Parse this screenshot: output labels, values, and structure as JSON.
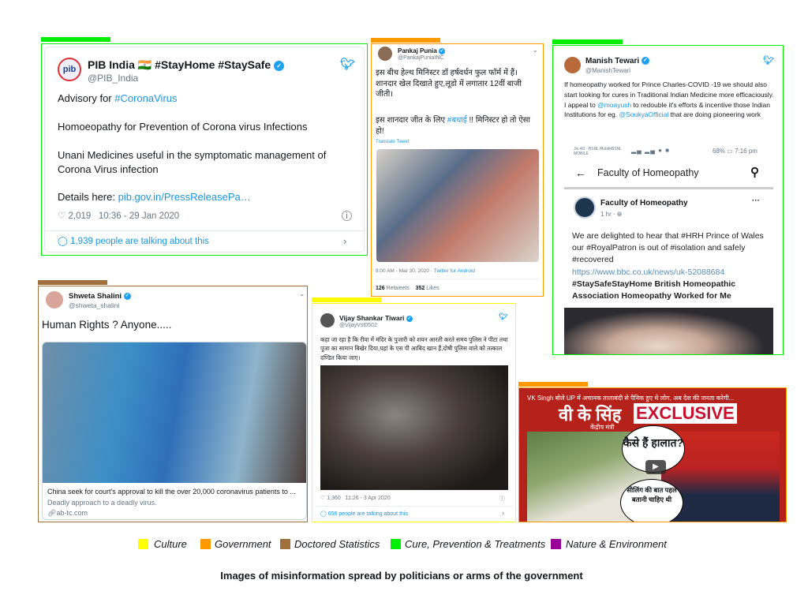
{
  "tweets": {
    "pib": {
      "name": "PIB India 🇮🇳 #StayHome #StaySafe",
      "handle": "@PIB_India",
      "line1_prefix": "Advisory for ",
      "line1_tag": "#CoronaVirus",
      "line2": "Homoeopathy for Prevention of Corona virus Infections",
      "line3": "Unani Medicines useful in the symptomatic management of Corona Virus infection",
      "details_prefix": "Details here: ",
      "details_link": "pib.gov.in/PressReleasePa…",
      "likes": "2,019",
      "time": "10:36 - 29 Jan 2020",
      "talking": "1,939 people are talking about this"
    },
    "pankaj": {
      "name": "Pankaj Punia",
      "handle": "@PankajPuniaINC",
      "text1": "इस बीच हेल्थ मिनिस्टर डॉ हर्षवर्धन फुल फॉर्म में हैं। शानदार खेल दिखाते हुए,लूडो में लगातार 12वीं बाजी जीती।",
      "text2_prefix": "इस शानदार जीत के लिए ",
      "text2_tag": "#बधाई",
      "text2_suffix": " !!  मिनिस्टर हो तो ऐसा हो!",
      "translate": "Translate Tweet",
      "time": "8:00 AM - Mar 30, 2020 · ",
      "source": "Twitter for Android",
      "retweets": "126",
      "retweets_label": "Retweets",
      "likes": "352",
      "likes_label": "Likes"
    },
    "manish": {
      "name": "Manish Tewari",
      "handle": "@ManishTewari",
      "text1": "If homeopathy worked for Prince Charles-COVID -19 we should also start looking for cures in Traditional Indian Medicine more efficaciously.",
      "text2_a": "I appeal to ",
      "mention1": "@moayush",
      "text2_b": " to redouble it's efforts & incentive those Indian Institutions for eg. ",
      "mention2": "@SoukyaOfficial",
      "text2_c": " that are doing pioneering work",
      "screenshot": {
        "carrier": "Jio 4G · BSNL MobileBSNL MOBILE",
        "battery": "68%",
        "clock": "7:16 pm",
        "page_title": "Faculty of Homeopathy",
        "post_author": "Faculty of Homeopathy",
        "post_time": "1 hr ·",
        "post_text": "We are delighted to hear that #HRH Prince of Wales our  #RoyalPatron is out of #isolation and safely #recovered",
        "post_link": "https://www.bbc.co.uk/news/uk-52088684",
        "post_tags": "#StaySafeStayHome British Homeopathic Association Homeopathy Worked for Me"
      }
    },
    "shweta": {
      "name": "Shweta Shalini",
      "handle": "@shweta_shalini",
      "text": "Human Rights ? Anyone.....",
      "card_title": "China seek for court's approval to kill the over 20,000 coronavirus patients to ...",
      "card_desc": "Deadly approach to a deadly virus.",
      "card_domain": "ab-tc.com"
    },
    "vijay": {
      "name": "Vijay Shankar Tiwari",
      "handle": "@VijayVst0502",
      "text": "कहा जा रहा है कि रीवा में मंदिर के पुजारी को शयन आरती करते समय पुलिस ने पीटा तथा पूजा का सामान बिखेर दिया,यहां के एस पी आबिद खान हैं,दोषी पुलिस वाले को तत्काल दण्डित किया जाए।",
      "likes": "1,360",
      "time": "11:26 - 3 Apr 2020",
      "talking": "656 people are talking about this"
    },
    "video": {
      "title": "VK Singh बोले UP में अचानक तालाबंदी से पैनिक हुए थे लोग, अब देश की जनता करेगी...",
      "name_hi": "वी के सिंह",
      "role_hi": "केंद्रीय मंत्री",
      "banner": "EXCLUSIVE",
      "bubble1": "कैसे हैं हालात?",
      "bubble2": "सीलिंग की बात पहले बतानी चाहिए थी"
    }
  },
  "legend": [
    {
      "label": "Culture",
      "color": "#ffff00"
    },
    {
      "label": "Government",
      "color": "#ff9900"
    },
    {
      "label": "Doctored Statistics",
      "color": "#a0703c"
    },
    {
      "label": "Cure, Prevention & Treatments",
      "color": "#00ee00"
    },
    {
      "label": "Nature & Environment",
      "color": "#990099"
    }
  ],
  "caption": "Images of misinformation spread by politicians or arms of the government"
}
